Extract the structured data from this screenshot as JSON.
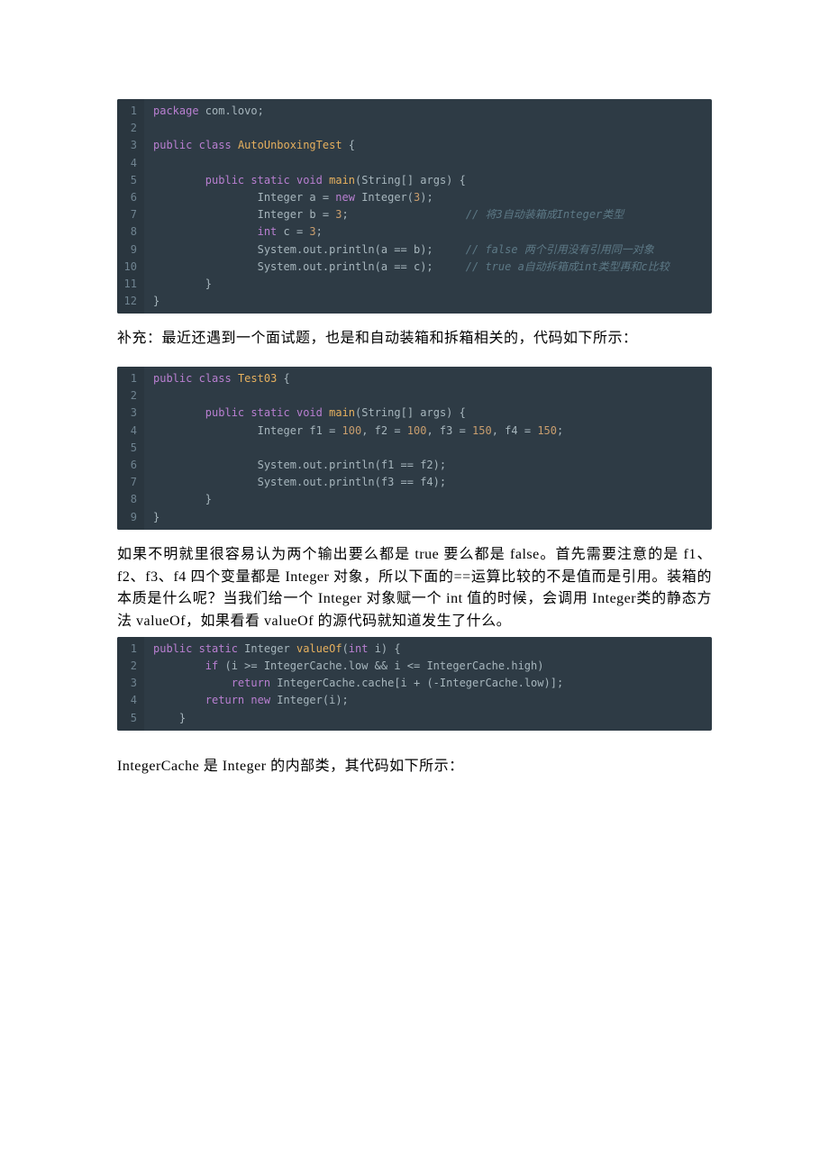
{
  "codeblocks": {
    "a": {
      "line_count": 12,
      "html": "<span class=\"tok-kw\">package</span> com.lovo;\n\n<span class=\"tok-kw\">public</span> <span class=\"tok-kw\">class</span> <span class=\"tok-cls\">AutoUnboxingTest</span> {\n\n        <span class=\"tok-kw\">public</span> <span class=\"tok-kw\">static</span> <span class=\"tok-kw\">void</span> <span class=\"tok-fn\">main</span>(String[] args) {\n                Integer a = <span class=\"tok-kw\">new</span> Integer(<span class=\"tok-num\">3</span>);\n                Integer b = <span class=\"tok-num\">3</span>;                  <span class=\"tok-com\">// 将3自动装箱成Integer类型</span>\n                <span class=\"tok-kw\">int</span> c = <span class=\"tok-num\">3</span>;\n                System.out.println(a == b);     <span class=\"tok-com\">// false 两个引用没有引用同一对象</span>\n                System.out.println(a == c);     <span class=\"tok-com\">// true a自动拆箱成int类型再和c比较</span>\n        }\n}"
    },
    "b": {
      "line_count": 9,
      "html": "<span class=\"tok-kw\">public</span> <span class=\"tok-kw\">class</span> <span class=\"tok-cls\">Test03</span> {\n\n        <span class=\"tok-kw\">public</span> <span class=\"tok-kw\">static</span> <span class=\"tok-kw\">void</span> <span class=\"tok-fn\">main</span>(String[] args) {\n                Integer f1 = <span class=\"tok-num\">100</span>, f2 = <span class=\"tok-num\">100</span>, f3 = <span class=\"tok-num\">150</span>, f4 = <span class=\"tok-num\">150</span>;\n\n                System.out.println(f1 == f2);\n                System.out.println(f3 == f4);\n        }\n}"
    },
    "c": {
      "line_count": 5,
      "html": "<span class=\"tok-kw\">public</span> <span class=\"tok-kw\">static</span> Integer <span class=\"tok-fn\">valueOf</span>(<span class=\"tok-kw\">int</span> i) {\n        <span class=\"tok-kw\">if</span> (i &gt;= IntegerCache.low &amp;&amp; i &lt;= IntegerCache.high)\n            <span class=\"tok-kw\">return</span> IntegerCache.cache[i + (-IntegerCache.low)];\n        <span class=\"tok-kw\">return</span> <span class=\"tok-kw\">new</span> Integer(i);\n    }"
    }
  },
  "paragraphs": {
    "p1": "补充：最近还遇到一个面试题，也是和自动装箱和拆箱相关的，代码如下所示：",
    "p2": "如果不明就里很容易认为两个输出要么都是 true 要么都是 false。首先需要注意的是 f1、f2、f3、f4 四个变量都是 Integer 对象，所以下面的==运算比较的不是值而是引用。装箱的本质是什么呢？当我们给一个 Integer 对象赋一个 int 值的时候，会调用 Integer类的静态方法 valueOf，如果看看 valueOf 的源代码就知道发生了什么。",
    "p3": "IntegerCache 是 Integer 的内部类，其代码如下所示："
  }
}
